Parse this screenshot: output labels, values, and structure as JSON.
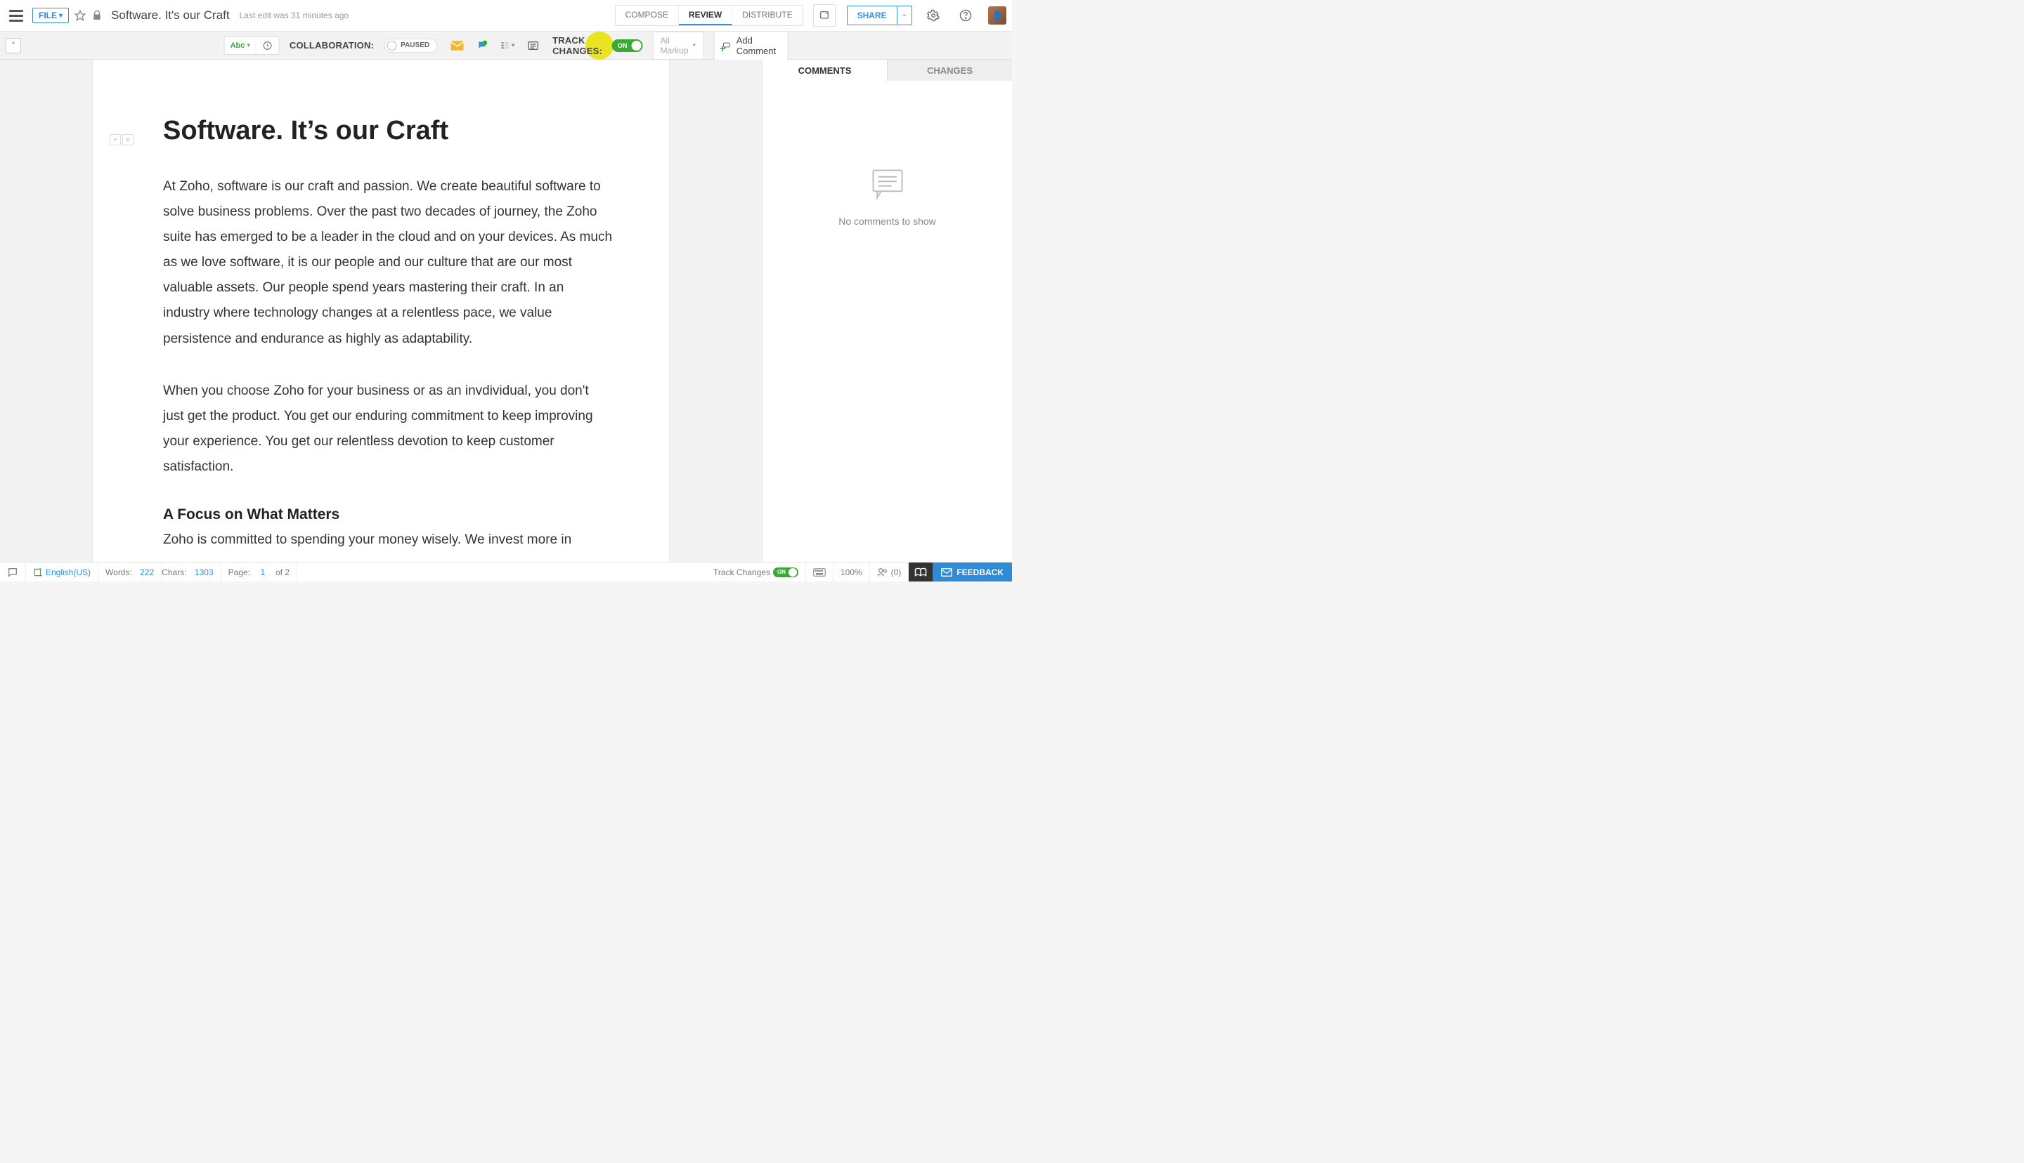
{
  "header": {
    "file_label": "FILE",
    "doc_title": "Software. It's our Craft",
    "last_edit": "Last edit was 31 minutes ago",
    "modes": {
      "compose": "COMPOSE",
      "review": "REVIEW",
      "distribute": "DISTRIBUTE"
    },
    "share": "SHARE"
  },
  "toolbar": {
    "collaboration_label": "COLLABORATION:",
    "paused": "PAUSED",
    "track_changes_label": "TRACK CHANGES:",
    "toggle_on": "ON",
    "markup_selected": "All Markup",
    "add_comment": "Add Comment"
  },
  "document": {
    "title": "Software. It’s our Craft",
    "para1": "At Zoho, software is our craft and passion. We create beautiful software to solve business problems. Over the past two decades of  journey, the Zoho suite has emerged to be a leader in the cloud and on your devices.   As much as we love software, it is our people and our culture that are our most valuable assets.   Our people spend years mastering their  craft. In an industry where technology changes at a relentless pace, we value persistence and endurance as highly as adaptability.",
    "para2": "When you choose Zoho for your business or as an invdividual, you don't just get the product. You get our enduring commitment to keep improving your experience.  You get our relentless devotion to keep customer satisfaction.",
    "subhead": "A Focus on What Matters",
    "cutline": "Zoho is committed to spending your money wisely. We invest more in"
  },
  "side": {
    "comments": "COMMENTS",
    "changes": "CHANGES",
    "empty": "No comments to show"
  },
  "status": {
    "language": "English(US)",
    "words_label": "Words:",
    "words": "222",
    "chars_label": "Chars:",
    "chars": "1303",
    "page_label": "Page:",
    "page_num": "1",
    "page_of": "of 2",
    "track_label": "Track Changes",
    "track_on": "ON",
    "zoom": "100%",
    "collab_count": "(0)",
    "feedback": "FEEDBACK"
  }
}
